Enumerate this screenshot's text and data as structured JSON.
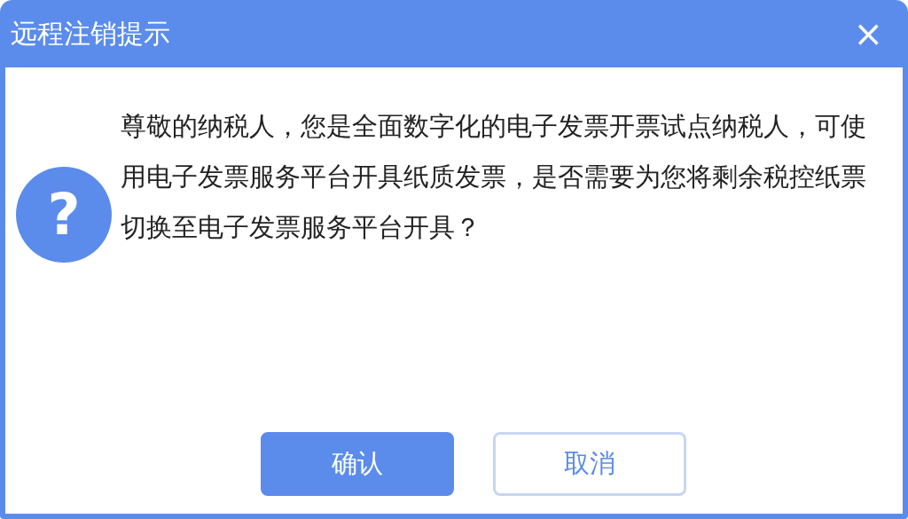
{
  "window": {
    "title": "远程注销提示",
    "close": "×"
  },
  "dialog": {
    "icon_glyph": "?",
    "message": "尊敬的纳税人，您是全面数字化的电子发票开票试点纳税人，可使用电子发票服务平台开具纸质发票，是否需要为您将剩余税控纸票切换至电子发票服务平台开具？"
  },
  "buttons": [
    {
      "label": "确认",
      "kind": "primary"
    },
    {
      "label": "取消",
      "kind": "secondary"
    }
  ]
}
